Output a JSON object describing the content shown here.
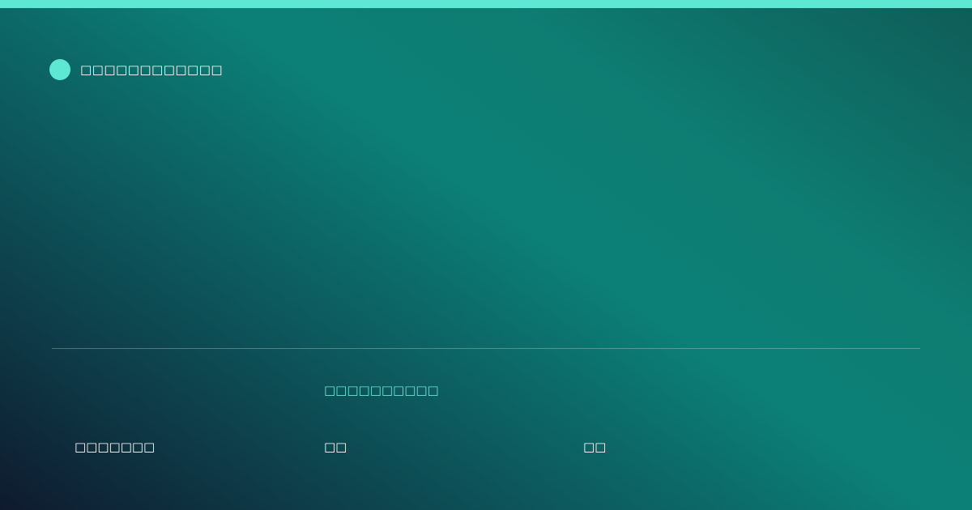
{
  "brand": {
    "name": "□□□□□□□□□□□□",
    "dot_color": "#5ee8d4"
  },
  "accent_color": "#5ee8d4",
  "footer": {
    "heading": "□□□□□□□□□□",
    "items": [
      "□□□□□□□",
      "□□",
      "□□"
    ]
  }
}
